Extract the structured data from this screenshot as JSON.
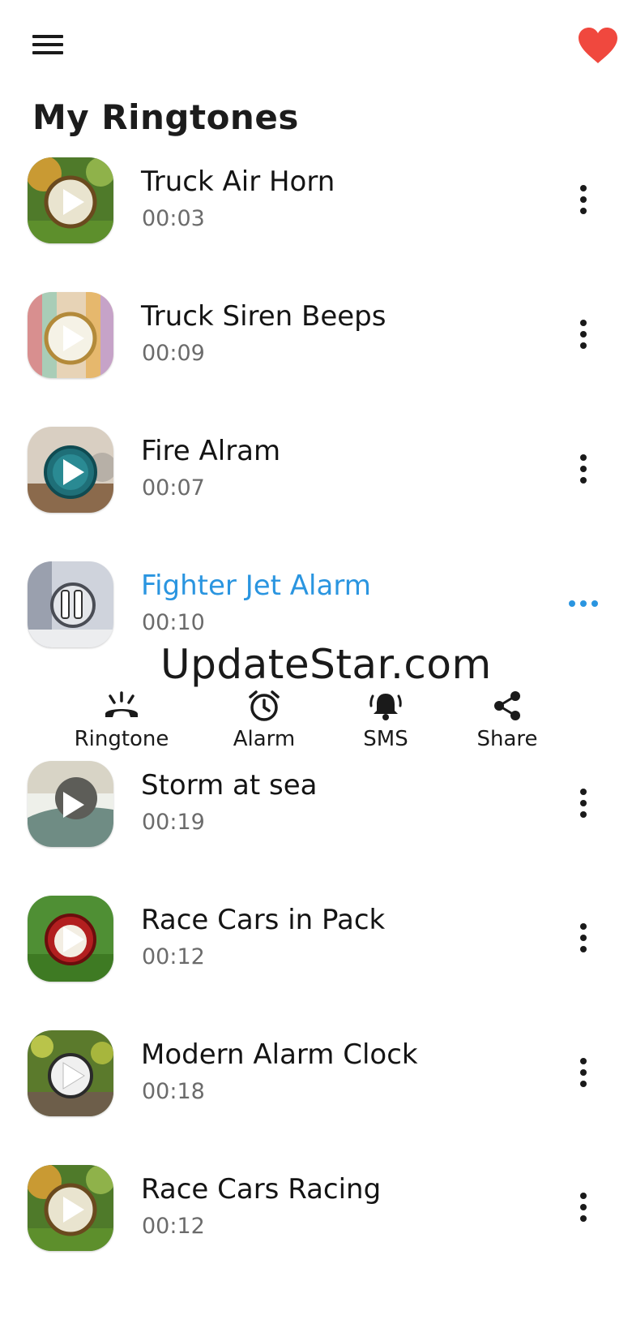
{
  "header": {
    "menu_icon": "hamburger-menu-icon",
    "favorite_icon": "heart-icon",
    "favorite_color": "#f0483e",
    "title": "My Ringtones"
  },
  "accent_color": "#2a95e0",
  "ringtones": [
    {
      "title": "Truck Air Horn",
      "duration": "00:03"
    },
    {
      "title": "Truck Siren Beeps",
      "duration": "00:09"
    },
    {
      "title": "Fire Alram",
      "duration": "00:07"
    },
    {
      "title": "Fighter Jet Alarm",
      "duration": "00:10"
    },
    {
      "title": "Storm at sea",
      "duration": "00:19"
    },
    {
      "title": "Race Cars in Pack",
      "duration": "00:12"
    },
    {
      "title": "Modern Alarm Clock",
      "duration": "00:18"
    },
    {
      "title": "Race Cars Racing",
      "duration": "00:12"
    }
  ],
  "selected_index": 3,
  "actions": [
    {
      "label": "Ringtone",
      "icon": "phone-ringing-icon"
    },
    {
      "label": "Alarm",
      "icon": "alarm-clock-icon"
    },
    {
      "label": "SMS",
      "icon": "bell-ringing-icon"
    },
    {
      "label": "Share",
      "icon": "share-icon"
    }
  ],
  "watermark": "UpdateStar.com"
}
